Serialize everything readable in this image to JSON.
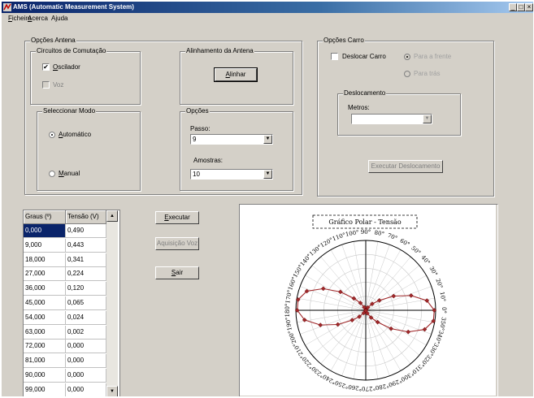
{
  "window": {
    "title": "AMS (Automatic Measurement System)",
    "controls": [
      "_",
      "□",
      "×"
    ]
  },
  "menu": [
    {
      "label": "Ficheiro",
      "u": "F"
    },
    {
      "label": "Acerca",
      "u": "A"
    },
    {
      "label": "Ajuda",
      "u": "j"
    }
  ],
  "opcoes_antena": {
    "title": "Opções Antena",
    "circuitos": {
      "title": "Circuitos de Comutação",
      "oscilador": {
        "label": "Oscilador",
        "checked": true
      },
      "voz": {
        "label": "Voz",
        "checked": false,
        "disabled": true
      }
    },
    "alinhamento": {
      "title": "Alinhamento da Antena",
      "button": "Alinhar"
    },
    "modo": {
      "title": "Seleccionar Modo",
      "automatico": {
        "label": "Automático",
        "selected": true
      },
      "manual": {
        "label": "Manual",
        "selected": false
      }
    },
    "opcoes": {
      "title": "Opções",
      "passo_label": "Passo:",
      "passo_value": "9",
      "amostras_label": "Amostras:",
      "amostras_value": "10"
    }
  },
  "opcoes_carro": {
    "title": "Opções Carro",
    "deslocar": {
      "label": "Deslocar Carro",
      "checked": false
    },
    "para_frente": {
      "label": "Para a frente",
      "selected": true,
      "disabled": true
    },
    "para_tras": {
      "label": "Para trás",
      "selected": false,
      "disabled": true
    },
    "deslocamento": {
      "title": "Deslocamento",
      "metros_label": "Metros:",
      "metros_value": ""
    },
    "executar_button": "Executar Deslocamento"
  },
  "actions": {
    "executar": "Executar",
    "aquisicao_voz": "Aquisição Voz",
    "sair": "Sair"
  },
  "table": {
    "headers": [
      "Graus (º)",
      "Tensão (V)"
    ],
    "selected_row": 0,
    "rows": [
      [
        "0,000",
        "0,490"
      ],
      [
        "9,000",
        "0,443"
      ],
      [
        "18,000",
        "0,341"
      ],
      [
        "27,000",
        "0,224"
      ],
      [
        "36,000",
        "0,120"
      ],
      [
        "45,000",
        "0,065"
      ],
      [
        "54,000",
        "0,024"
      ],
      [
        "63,000",
        "0,002"
      ],
      [
        "72,000",
        "0,000"
      ],
      [
        "81,000",
        "0,000"
      ],
      [
        "90,000",
        "0,000"
      ],
      [
        "99,000",
        "0,000"
      ]
    ]
  },
  "chart_data": {
    "type": "scatter",
    "title": "Gráfico Polar - Tensão",
    "angle_ticks": [
      "0°",
      "10°",
      "20°",
      "30°",
      "40°",
      "50°",
      "60°",
      "70°",
      "80°",
      "90°",
      "100°",
      "110°",
      "120°",
      "130°",
      "140°",
      "150°",
      "160°",
      "170°",
      "180°",
      "190°",
      "200°",
      "210°",
      "220°",
      "230°",
      "240°",
      "250°",
      "260°",
      "270°",
      "280°",
      "290°",
      "300°",
      "310°",
      "320°",
      "330°",
      "340°",
      "350°"
    ],
    "r_max": 0.5,
    "grid": true,
    "series": [
      {
        "color": "#a0282a",
        "theta": [
          0,
          9,
          18,
          27,
          36,
          45,
          54,
          63,
          72,
          81,
          90,
          99,
          108,
          117,
          126,
          135,
          144,
          153,
          162,
          171,
          180,
          189,
          198,
          207,
          216,
          225,
          234,
          243,
          252,
          261,
          270,
          279,
          288,
          297,
          306,
          315,
          324,
          333,
          342,
          351
        ],
        "r": [
          0.49,
          0.443,
          0.341,
          0.224,
          0.12,
          0.065,
          0.024,
          0.002,
          0.0,
          0.0,
          0.0,
          0.0,
          0.002,
          0.024,
          0.065,
          0.12,
          0.224,
          0.341,
          0.443,
          0.49,
          0.49,
          0.443,
          0.341,
          0.224,
          0.12,
          0.065,
          0.024,
          0.002,
          0.0,
          0.0,
          0.0,
          0.0,
          0.002,
          0.024,
          0.065,
          0.12,
          0.224,
          0.341,
          0.443,
          0.49
        ]
      }
    ]
  }
}
